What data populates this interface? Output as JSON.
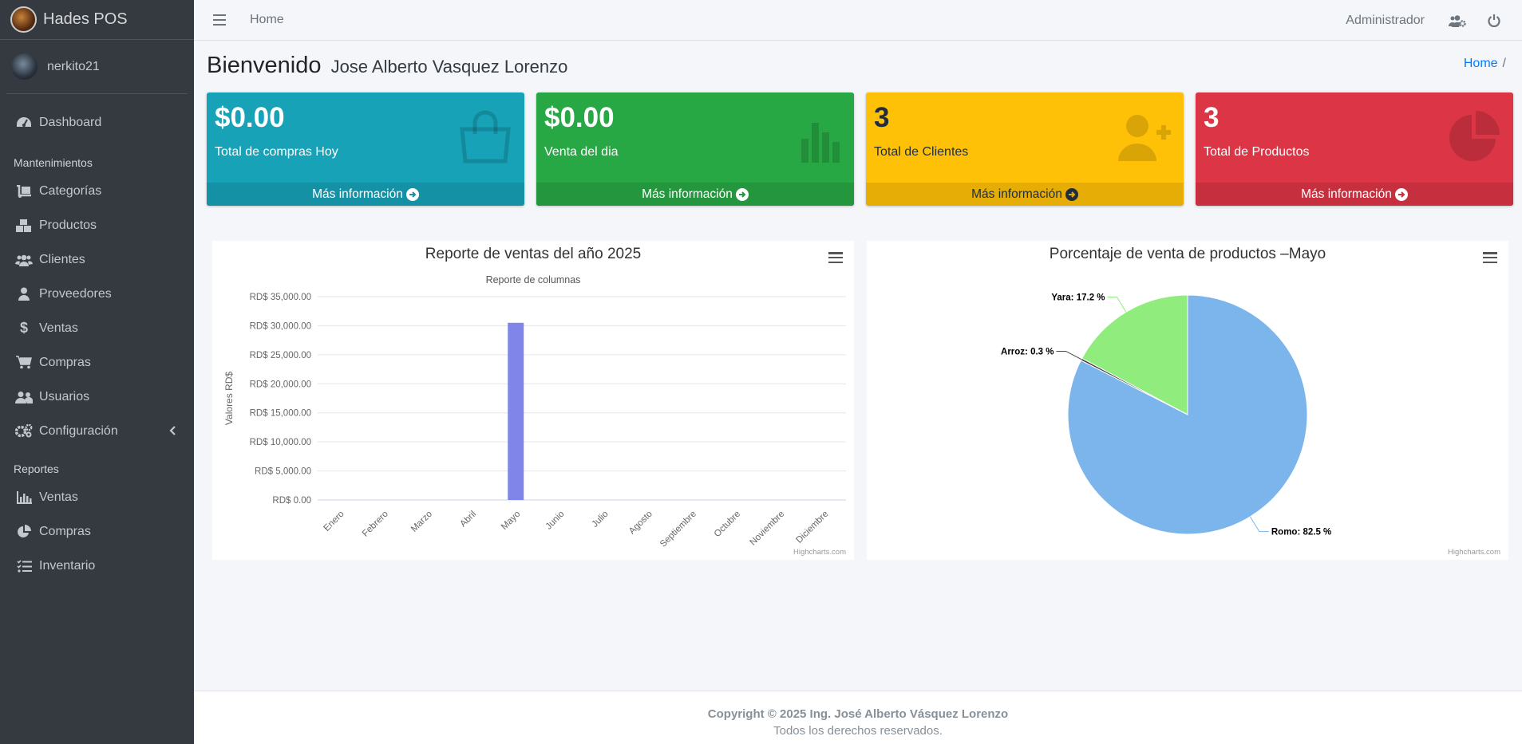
{
  "app": {
    "brand": "Hades POS",
    "user": "nerkito21"
  },
  "sidebar": {
    "dashboard": "Dashboard",
    "header_mant": "Mantenimientos",
    "mant_items": [
      {
        "label": "Categorías",
        "icon": "dolly-icon"
      },
      {
        "label": "Productos",
        "icon": "boxes-icon"
      },
      {
        "label": "Clientes",
        "icon": "users-icon"
      },
      {
        "label": "Proveedores",
        "icon": "user-icon"
      },
      {
        "label": "Ventas",
        "icon": "dollar-icon"
      },
      {
        "label": "Compras",
        "icon": "cart-icon"
      },
      {
        "label": "Usuarios",
        "icon": "user-friends-icon"
      },
      {
        "label": "Configuración",
        "icon": "cogs-icon"
      }
    ],
    "header_rep": "Reportes",
    "rep_items": [
      {
        "label": "Ventas",
        "icon": "bar-chart-icon"
      },
      {
        "label": "Compras",
        "icon": "pie-chart-icon"
      },
      {
        "label": "Inventario",
        "icon": "tasks-icon"
      }
    ]
  },
  "header": {
    "home": "Home",
    "role": "Administrador"
  },
  "page": {
    "title": "Bienvenido",
    "subtitle": "Jose Alberto Vasquez Lorenzo",
    "breadcrumb": "Home",
    "breadcrumb_sep": "/"
  },
  "boxes": [
    {
      "value": "$0.00",
      "label": "Total de compras Hoy",
      "link": "Más información",
      "bg": "#17a2b8",
      "foot": "#1591a5",
      "icon": "shopping-bag-icon"
    },
    {
      "value": "$0.00",
      "label": "Venta del dia",
      "link": "Más información",
      "bg": "#28a745",
      "foot": "#24963e",
      "icon": "bar-chart-icon"
    },
    {
      "value": "3",
      "label": "Total de Clientes",
      "link": "Más información",
      "bg": "#ffc107",
      "foot": "#e5ad06",
      "icon": "user-plus-icon"
    },
    {
      "value": "3",
      "label": "Total de Productos",
      "link": "Más información",
      "bg": "#dc3545",
      "foot": "#c6303e",
      "icon": "pie-chart-icon"
    }
  ],
  "charts": {
    "credit": "Highcharts.com"
  },
  "chart_data": [
    {
      "type": "bar",
      "title": "Reporte de ventas del año 2025",
      "subtitle": "Reporte de columnas",
      "ylabel": "Valores RD$",
      "ylim": [
        0,
        35000
      ],
      "yticks": [
        "RD$ 35,000.00",
        "RD$ 30,000.00",
        "RD$ 25,000.00",
        "RD$ 20,000.00",
        "RD$ 15,000.00",
        "RD$ 10,000.00",
        "RD$ 5,000.00",
        "RD$ 0.00"
      ],
      "categories": [
        "Enero",
        "Febrero",
        "Marzo",
        "Abril",
        "Mayo",
        "Junio",
        "Julio",
        "Agosto",
        "Septiembre",
        "Octubre",
        "Noviembre",
        "Diciembre"
      ],
      "values": [
        0,
        0,
        0,
        0,
        30500,
        0,
        0,
        0,
        0,
        0,
        0,
        0
      ],
      "color": "#8085e9"
    },
    {
      "type": "pie",
      "title": "Porcentaje de venta de productos –Mayo",
      "slices": [
        {
          "name": "Yara",
          "value": 17.2,
          "label": "Yara: 17.2 %",
          "color": "#90ed7d"
        },
        {
          "name": "Arroz",
          "value": 0.3,
          "label": "Arroz: 0.3 %",
          "color": "#434348"
        },
        {
          "name": "Romo",
          "value": 82.5,
          "label": "Romo: 82.5 %",
          "color": "#7cb5ec"
        }
      ]
    }
  ],
  "footer": {
    "copyright": "Copyright © 2025 Ing. José Alberto Vásquez Lorenzo",
    "rights": "Todos los derechos reservados."
  }
}
